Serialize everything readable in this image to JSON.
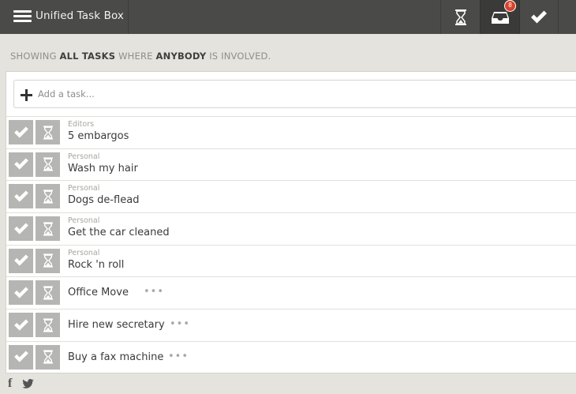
{
  "header": {
    "title": "Unified Task Box",
    "inbox_badge": "8"
  },
  "summary": {
    "prefix": "Showing",
    "scope": "All Tasks",
    "middle": "where",
    "who": "Anybody",
    "suffix": "is involved."
  },
  "add_task": {
    "placeholder": "Add a task..."
  },
  "tasks": [
    {
      "category": "Editors",
      "title": "5 embargos",
      "more": ""
    },
    {
      "category": "Personal",
      "title": "Wash my hair",
      "more": ""
    },
    {
      "category": "Personal",
      "title": "Dogs de-flead",
      "more": ""
    },
    {
      "category": "Personal",
      "title": "Get the car cleaned",
      "more": ""
    },
    {
      "category": "Personal",
      "title": "Rock 'n roll",
      "more": ""
    },
    {
      "category": "",
      "title": "Office Move",
      "more": "•••"
    },
    {
      "category": "",
      "title": "Hire new secretary",
      "more": "•••"
    },
    {
      "category": "",
      "title": "Buy a fax machine",
      "more": "•••"
    }
  ],
  "footer": {
    "facebook_glyph": "f"
  },
  "icons": {
    "menu": "hamburger-icon",
    "pending": "hourglass-icon",
    "inbox": "inbox-tray-icon",
    "done": "checkmark-icon",
    "add": "plus-icon",
    "facebook": "facebook-icon",
    "twitter": "twitter-icon"
  },
  "colors": {
    "topbar": "#4a4a48",
    "background": "#e4e3dd",
    "action_button": "#b5b5b3",
    "badge": "#d9422b"
  }
}
